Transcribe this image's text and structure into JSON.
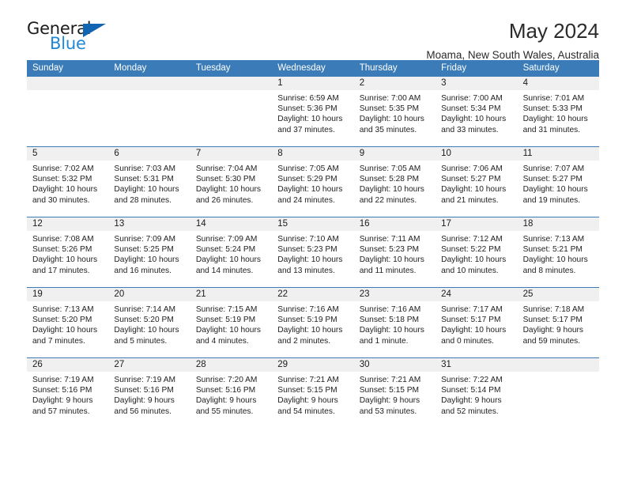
{
  "logo": {
    "word_one": "General",
    "word_two": "Blue",
    "triangle_icon": "triangle-icon",
    "colors": {
      "dark": "#1b1b1b",
      "blue": "#1f87d6",
      "triangle": "#1265b0"
    }
  },
  "header": {
    "title": "May 2024",
    "subtitle": "Moama, New South Wales, Australia"
  },
  "theme": {
    "header_bar": "#3b7cb8",
    "daynum_band": "#f0f0f0",
    "week_divider": "#3b7cb8",
    "text": "#222222"
  },
  "calendar": {
    "weekdays": [
      "Sunday",
      "Monday",
      "Tuesday",
      "Wednesday",
      "Thursday",
      "Friday",
      "Saturday"
    ],
    "weeks": [
      [
        {
          "day": "",
          "lines": []
        },
        {
          "day": "",
          "lines": []
        },
        {
          "day": "",
          "lines": []
        },
        {
          "day": "1",
          "lines": [
            "Sunrise: 6:59 AM",
            "Sunset: 5:36 PM",
            "Daylight: 10 hours",
            "and 37 minutes."
          ]
        },
        {
          "day": "2",
          "lines": [
            "Sunrise: 7:00 AM",
            "Sunset: 5:35 PM",
            "Daylight: 10 hours",
            "and 35 minutes."
          ]
        },
        {
          "day": "3",
          "lines": [
            "Sunrise: 7:00 AM",
            "Sunset: 5:34 PM",
            "Daylight: 10 hours",
            "and 33 minutes."
          ]
        },
        {
          "day": "4",
          "lines": [
            "Sunrise: 7:01 AM",
            "Sunset: 5:33 PM",
            "Daylight: 10 hours",
            "and 31 minutes."
          ]
        }
      ],
      [
        {
          "day": "5",
          "lines": [
            "Sunrise: 7:02 AM",
            "Sunset: 5:32 PM",
            "Daylight: 10 hours",
            "and 30 minutes."
          ]
        },
        {
          "day": "6",
          "lines": [
            "Sunrise: 7:03 AM",
            "Sunset: 5:31 PM",
            "Daylight: 10 hours",
            "and 28 minutes."
          ]
        },
        {
          "day": "7",
          "lines": [
            "Sunrise: 7:04 AM",
            "Sunset: 5:30 PM",
            "Daylight: 10 hours",
            "and 26 minutes."
          ]
        },
        {
          "day": "8",
          "lines": [
            "Sunrise: 7:05 AM",
            "Sunset: 5:29 PM",
            "Daylight: 10 hours",
            "and 24 minutes."
          ]
        },
        {
          "day": "9",
          "lines": [
            "Sunrise: 7:05 AM",
            "Sunset: 5:28 PM",
            "Daylight: 10 hours",
            "and 22 minutes."
          ]
        },
        {
          "day": "10",
          "lines": [
            "Sunrise: 7:06 AM",
            "Sunset: 5:27 PM",
            "Daylight: 10 hours",
            "and 21 minutes."
          ]
        },
        {
          "day": "11",
          "lines": [
            "Sunrise: 7:07 AM",
            "Sunset: 5:27 PM",
            "Daylight: 10 hours",
            "and 19 minutes."
          ]
        }
      ],
      [
        {
          "day": "12",
          "lines": [
            "Sunrise: 7:08 AM",
            "Sunset: 5:26 PM",
            "Daylight: 10 hours",
            "and 17 minutes."
          ]
        },
        {
          "day": "13",
          "lines": [
            "Sunrise: 7:09 AM",
            "Sunset: 5:25 PM",
            "Daylight: 10 hours",
            "and 16 minutes."
          ]
        },
        {
          "day": "14",
          "lines": [
            "Sunrise: 7:09 AM",
            "Sunset: 5:24 PM",
            "Daylight: 10 hours",
            "and 14 minutes."
          ]
        },
        {
          "day": "15",
          "lines": [
            "Sunrise: 7:10 AM",
            "Sunset: 5:23 PM",
            "Daylight: 10 hours",
            "and 13 minutes."
          ]
        },
        {
          "day": "16",
          "lines": [
            "Sunrise: 7:11 AM",
            "Sunset: 5:23 PM",
            "Daylight: 10 hours",
            "and 11 minutes."
          ]
        },
        {
          "day": "17",
          "lines": [
            "Sunrise: 7:12 AM",
            "Sunset: 5:22 PM",
            "Daylight: 10 hours",
            "and 10 minutes."
          ]
        },
        {
          "day": "18",
          "lines": [
            "Sunrise: 7:13 AM",
            "Sunset: 5:21 PM",
            "Daylight: 10 hours",
            "and 8 minutes."
          ]
        }
      ],
      [
        {
          "day": "19",
          "lines": [
            "Sunrise: 7:13 AM",
            "Sunset: 5:20 PM",
            "Daylight: 10 hours",
            "and 7 minutes."
          ]
        },
        {
          "day": "20",
          "lines": [
            "Sunrise: 7:14 AM",
            "Sunset: 5:20 PM",
            "Daylight: 10 hours",
            "and 5 minutes."
          ]
        },
        {
          "day": "21",
          "lines": [
            "Sunrise: 7:15 AM",
            "Sunset: 5:19 PM",
            "Daylight: 10 hours",
            "and 4 minutes."
          ]
        },
        {
          "day": "22",
          "lines": [
            "Sunrise: 7:16 AM",
            "Sunset: 5:19 PM",
            "Daylight: 10 hours",
            "and 2 minutes."
          ]
        },
        {
          "day": "23",
          "lines": [
            "Sunrise: 7:16 AM",
            "Sunset: 5:18 PM",
            "Daylight: 10 hours",
            "and 1 minute."
          ]
        },
        {
          "day": "24",
          "lines": [
            "Sunrise: 7:17 AM",
            "Sunset: 5:17 PM",
            "Daylight: 10 hours",
            "and 0 minutes."
          ]
        },
        {
          "day": "25",
          "lines": [
            "Sunrise: 7:18 AM",
            "Sunset: 5:17 PM",
            "Daylight: 9 hours",
            "and 59 minutes."
          ]
        }
      ],
      [
        {
          "day": "26",
          "lines": [
            "Sunrise: 7:19 AM",
            "Sunset: 5:16 PM",
            "Daylight: 9 hours",
            "and 57 minutes."
          ]
        },
        {
          "day": "27",
          "lines": [
            "Sunrise: 7:19 AM",
            "Sunset: 5:16 PM",
            "Daylight: 9 hours",
            "and 56 minutes."
          ]
        },
        {
          "day": "28",
          "lines": [
            "Sunrise: 7:20 AM",
            "Sunset: 5:16 PM",
            "Daylight: 9 hours",
            "and 55 minutes."
          ]
        },
        {
          "day": "29",
          "lines": [
            "Sunrise: 7:21 AM",
            "Sunset: 5:15 PM",
            "Daylight: 9 hours",
            "and 54 minutes."
          ]
        },
        {
          "day": "30",
          "lines": [
            "Sunrise: 7:21 AM",
            "Sunset: 5:15 PM",
            "Daylight: 9 hours",
            "and 53 minutes."
          ]
        },
        {
          "day": "31",
          "lines": [
            "Sunrise: 7:22 AM",
            "Sunset: 5:14 PM",
            "Daylight: 9 hours",
            "and 52 minutes."
          ]
        },
        {
          "day": "",
          "lines": []
        }
      ]
    ]
  }
}
